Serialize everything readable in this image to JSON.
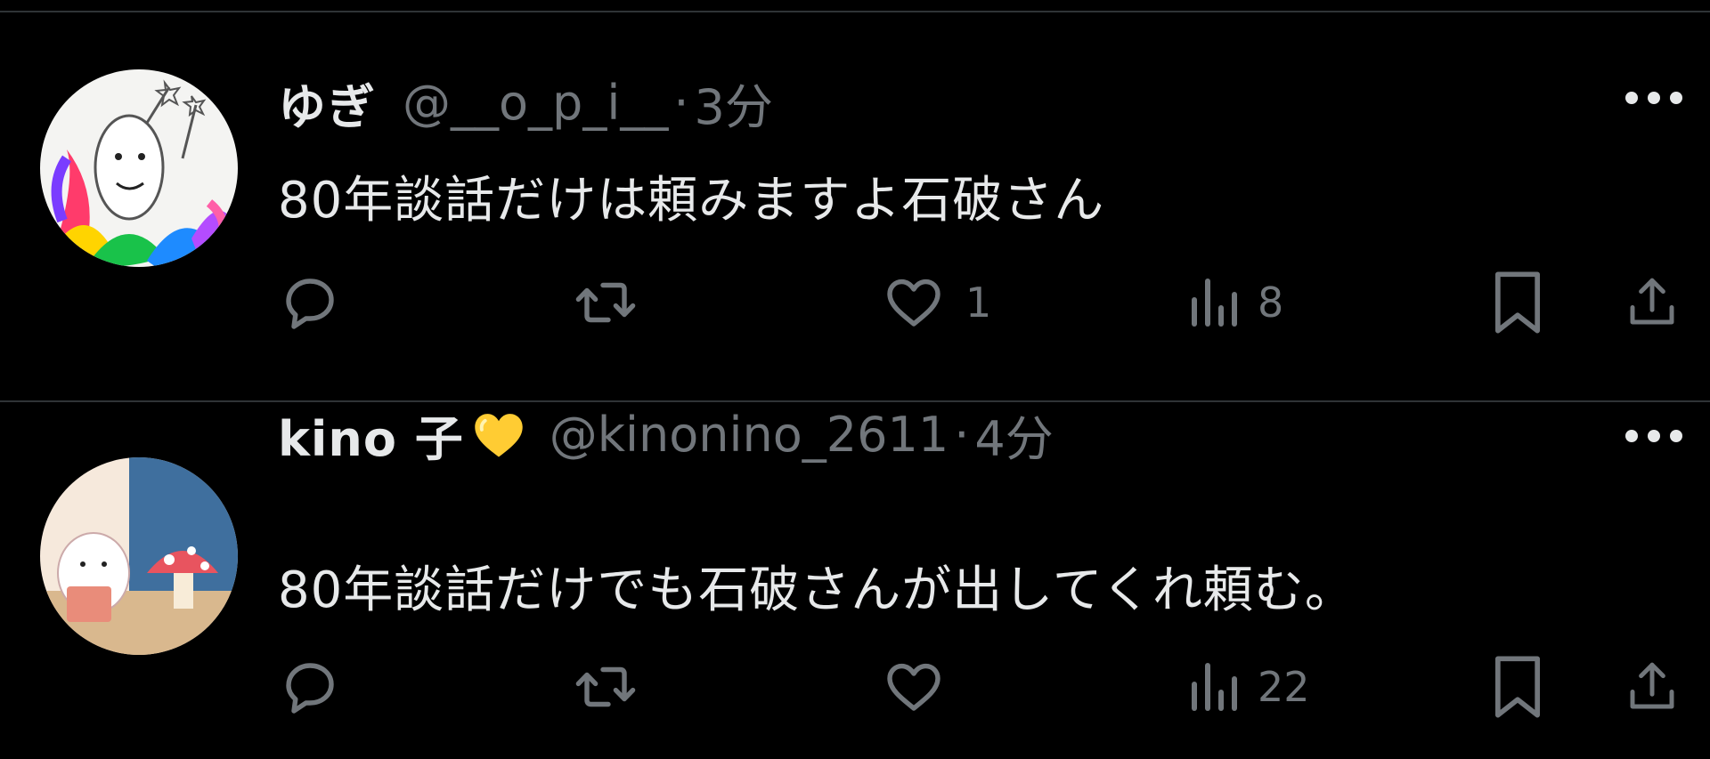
{
  "tweets": [
    {
      "display_name": "ゆぎ",
      "handle": "@__o_p_i__",
      "separator": "·",
      "time": "3分",
      "text": "80年談話だけは頼みますよ石破さん",
      "reply_count": "",
      "retweet_count": "",
      "like_count": "1",
      "view_count": "8",
      "avatar_icon": "squid-drawing-avatar",
      "badge_icon": ""
    },
    {
      "display_name": "kino 子",
      "handle": "@kinonino_2611",
      "separator": "·",
      "time": "4分",
      "text": "80年談話だけでも石破さんが出してくれ頼む。",
      "reply_count": "",
      "retweet_count": "",
      "like_count": "",
      "view_count": "22",
      "avatar_icon": "mushroom-illustration-avatar",
      "badge_icon": "yellow-heart-emoji"
    }
  ],
  "colors": {
    "background": "#000000",
    "primary_text": "#e7e9ea",
    "secondary_text": "#71767b",
    "divider": "#2f3336",
    "heart_emoji": "#ffcc33"
  }
}
